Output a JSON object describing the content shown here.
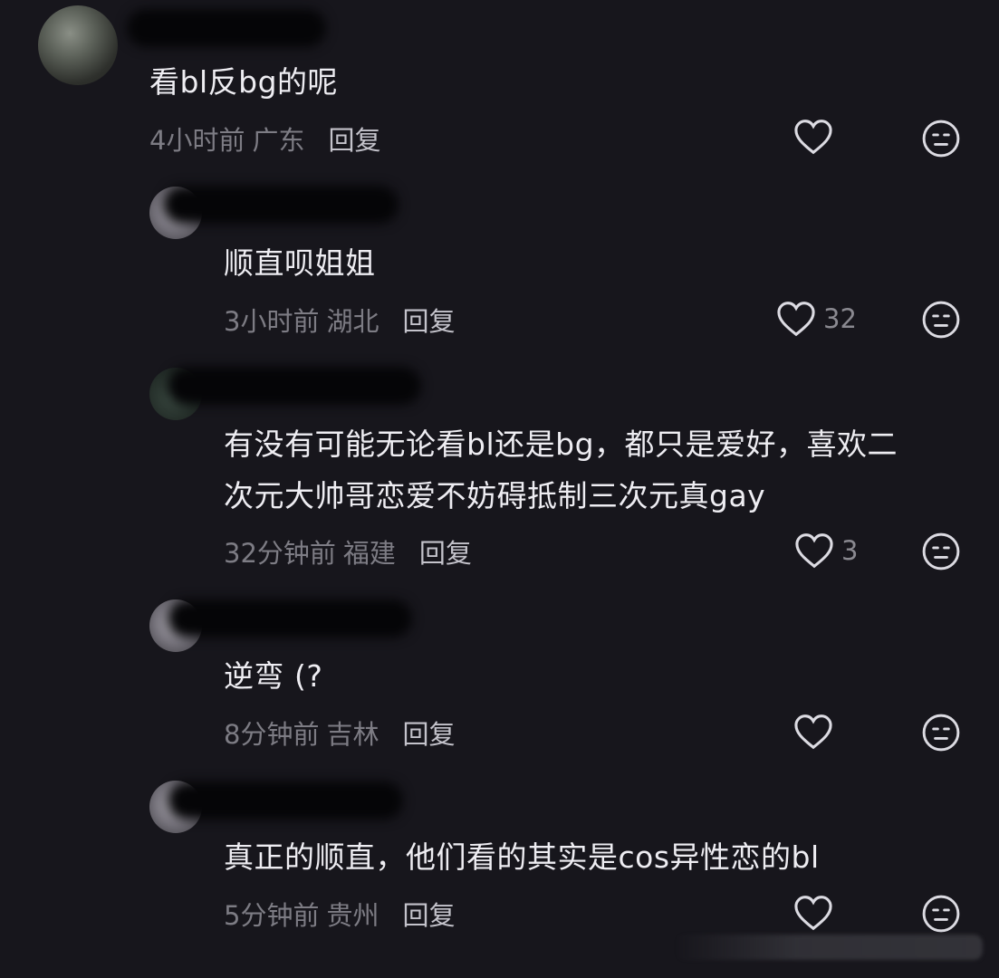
{
  "comments": [
    {
      "text": "看bl反bg的呢",
      "time": "4小时前",
      "location": "广东",
      "reply_label": "回复",
      "likes": ""
    },
    {
      "text": "顺直呗姐姐",
      "time": "3小时前",
      "location": "湖北",
      "reply_label": "回复",
      "likes": "32"
    },
    {
      "text_line1": "有没有可能无论看bl还是bg，都只是爱好，喜欢二",
      "text_line2": "次元大帅哥恋爱不妨碍抵制三次元真gay",
      "time": "32分钟前",
      "location": "福建",
      "reply_label": "回复",
      "likes": "3"
    },
    {
      "text": "逆弯 (?",
      "time": "8分钟前",
      "location": "吉林",
      "reply_label": "回复",
      "likes": ""
    },
    {
      "text": "真正的顺直，他们看的其实是cos异性恋的bl",
      "time": "5分钟前",
      "location": "贵州",
      "reply_label": "回复",
      "likes": ""
    }
  ],
  "icons": {
    "like": "heart-outline-icon",
    "dislike": "meh-face-icon"
  },
  "colors": {
    "background": "#17161c",
    "text": "#eeedf2",
    "meta": "#7d7c84",
    "reply": "#c4c3cb"
  }
}
